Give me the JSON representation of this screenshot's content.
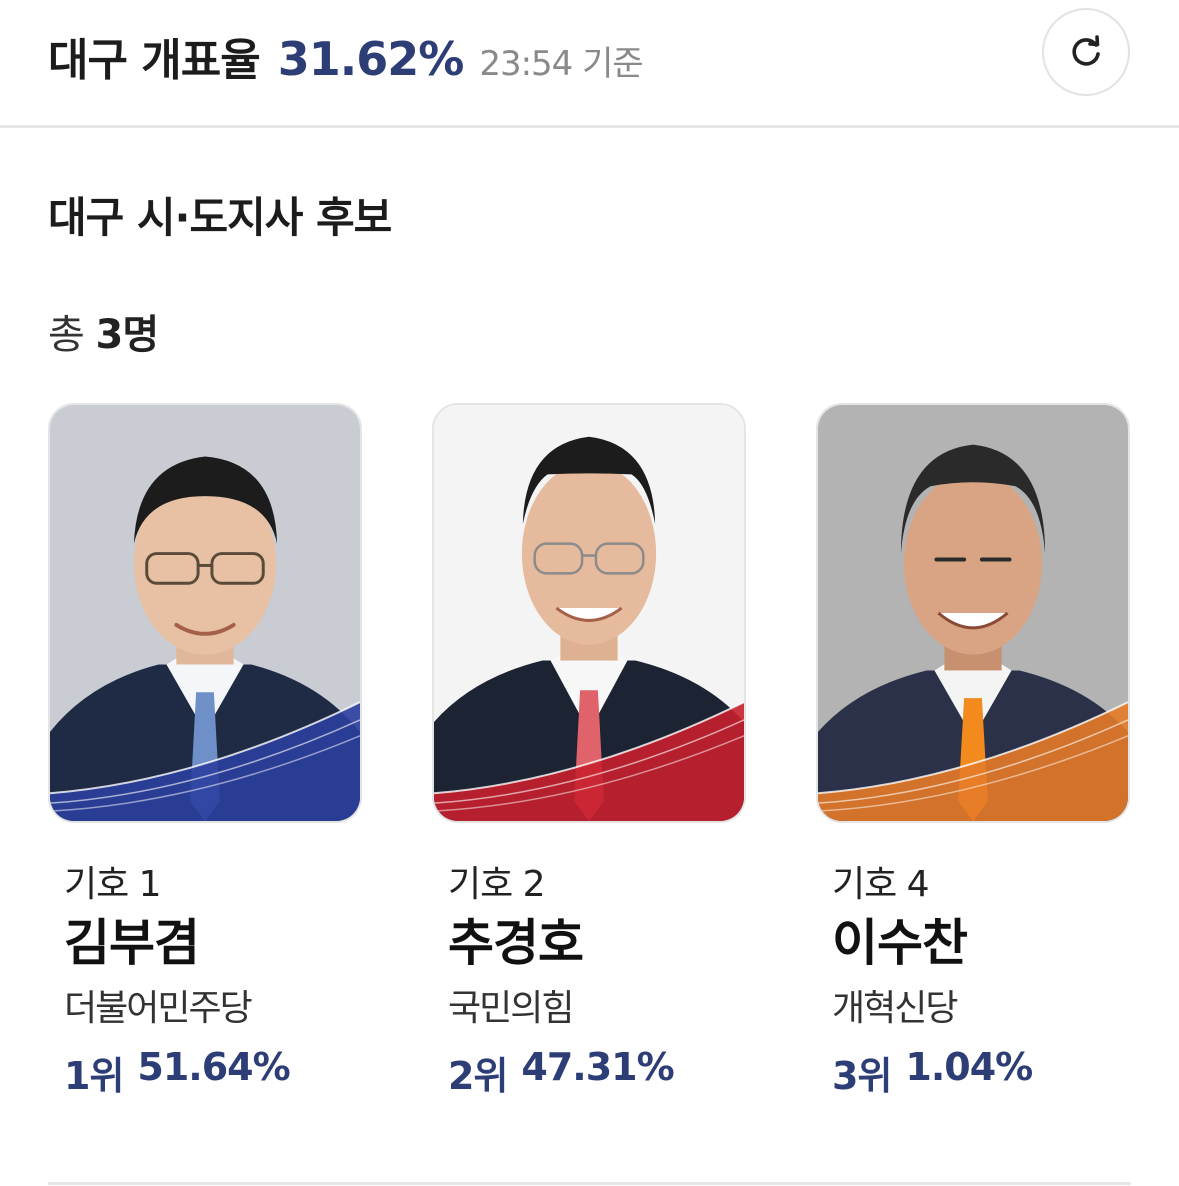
{
  "header": {
    "region_label": "대구 개표율",
    "count_rate": "31.62%",
    "timestamp": "23:54 기준",
    "refresh_icon": "refresh-icon"
  },
  "section": {
    "title": "대구 시·도지사 후보",
    "total_prefix": "총",
    "total_count": "3명"
  },
  "candidates": [
    {
      "number": "기호 1",
      "name": "김부겸",
      "party": "더불어민주당",
      "rank": "1위",
      "percent": "51.64%",
      "party_color": "#2b3f9e",
      "tie_color": "#6f8fc8",
      "bg_color": "#c9ccd2"
    },
    {
      "number": "기호 2",
      "name": "추경호",
      "party": "국민의힘",
      "rank": "2위",
      "percent": "47.31%",
      "party_color": "#c8202e",
      "tie_color": "#e0626a",
      "bg_color": "#f4f4f4"
    },
    {
      "number": "기호 4",
      "name": "이수찬",
      "party": "개혁신당",
      "rank": "3위",
      "percent": "1.04%",
      "party_color": "#e57b28",
      "tie_color": "#f28a1e",
      "bg_color": "#b3b3b3"
    }
  ]
}
